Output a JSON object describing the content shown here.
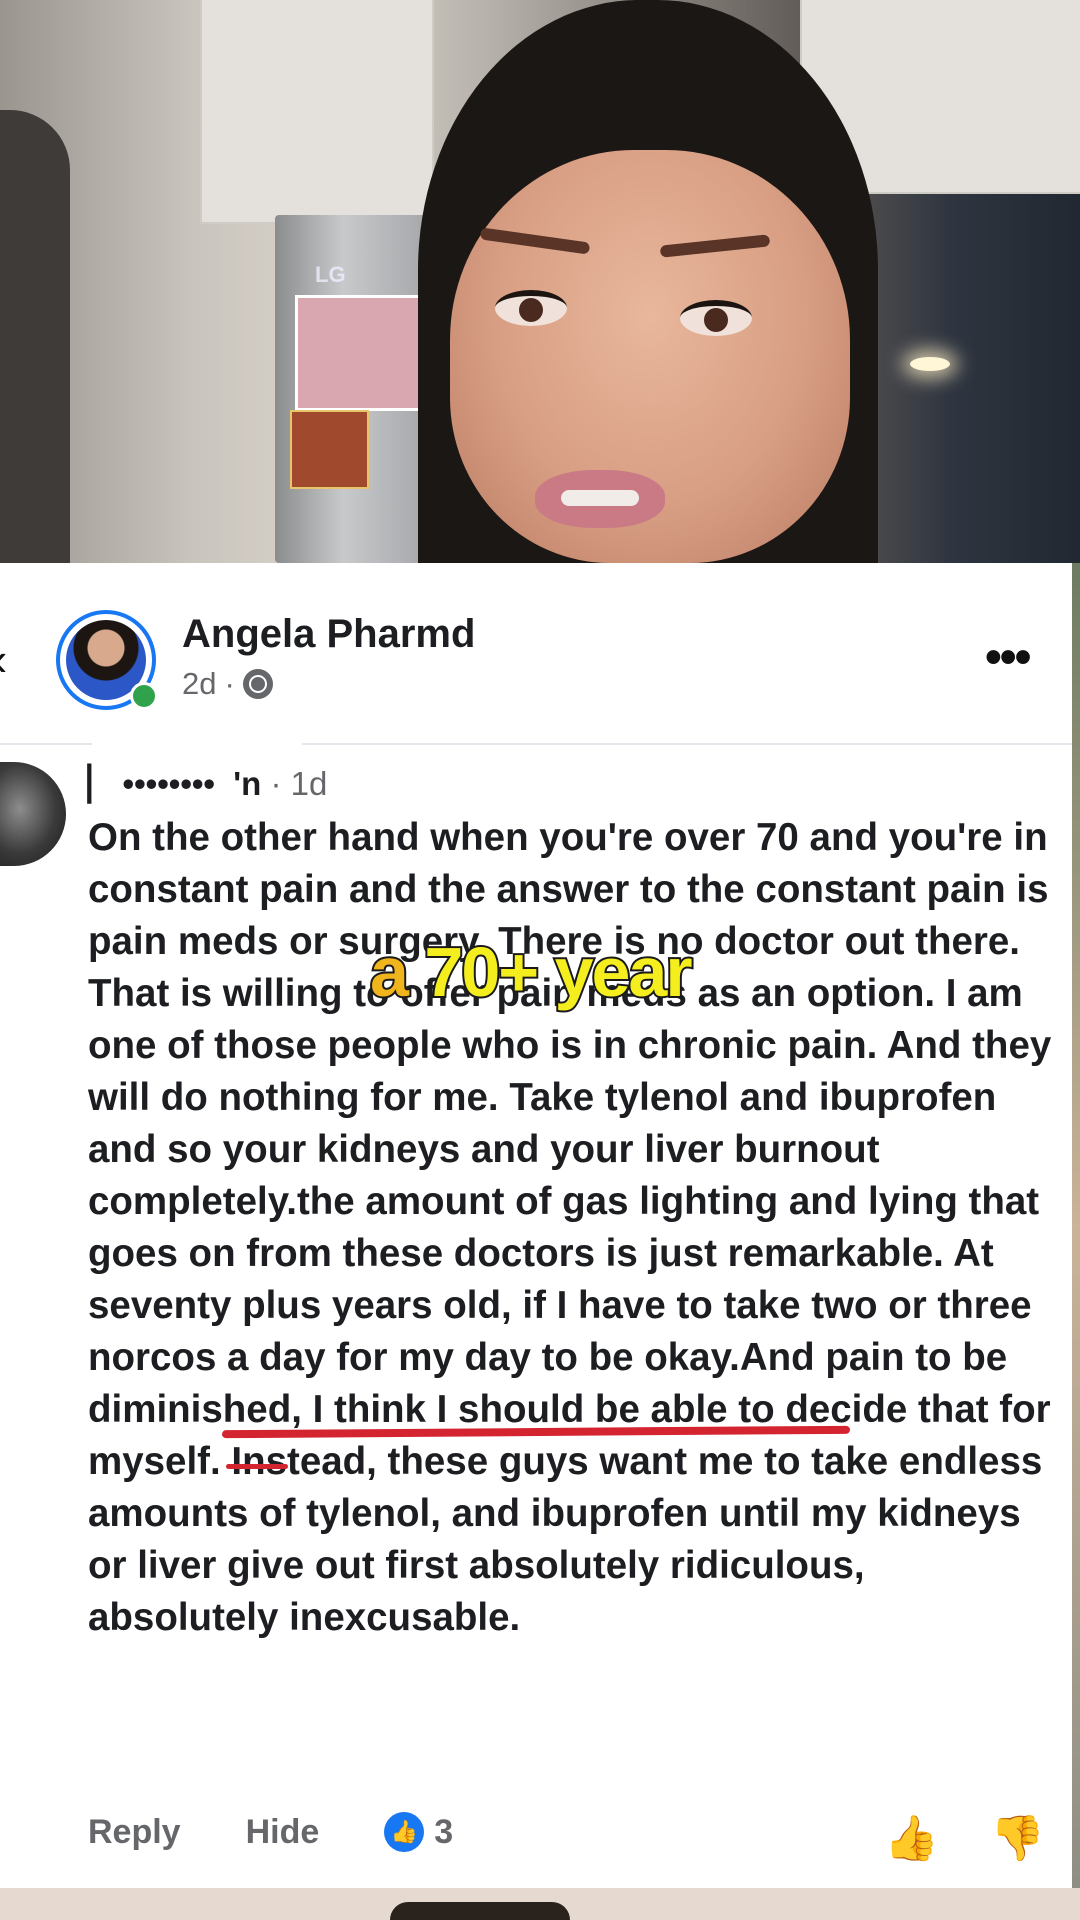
{
  "video": {
    "fridge_brand": "LG"
  },
  "post": {
    "author": "Angela Pharmd",
    "age": "2d",
    "separator": "·",
    "audience_icon": "globe-icon",
    "more_icon": "more-options-icon"
  },
  "comment": {
    "author_visible": "▏ ••••••••  'n",
    "time": "· 1d",
    "text": "On the other hand when you're over 70 and you're in constant pain and the answer to the constant pain is pain meds or surgery. There is no doctor out there. That is willing to offer pain meds as an option. I am one of those people who is in chronic pain. And they will do nothing for me. Take tylenol and ibuprofen and so your kidneys and your liver burnout completely.the amount of gas lighting and lying that goes on from these doctors is just remarkable. At seventy plus years old, if I have to take two or three norcos a day for my day to be okay.And pain to be diminished, I think I should be able to decide that for myself. Instead, these guys want me to take endless amounts of tylenol, and ibuprofen until my kidneys or liver give out first absolutely ridiculous, absolutely inexcusable.",
    "reply_label": "Reply",
    "hide_label": "Hide",
    "reaction_count": "3"
  },
  "caption": {
    "highlight": "a",
    "rest": " 70+ year"
  },
  "colors": {
    "accent": "#1877f2",
    "caption_yellow": "#f5ee1f",
    "underline_red": "#d42430"
  }
}
